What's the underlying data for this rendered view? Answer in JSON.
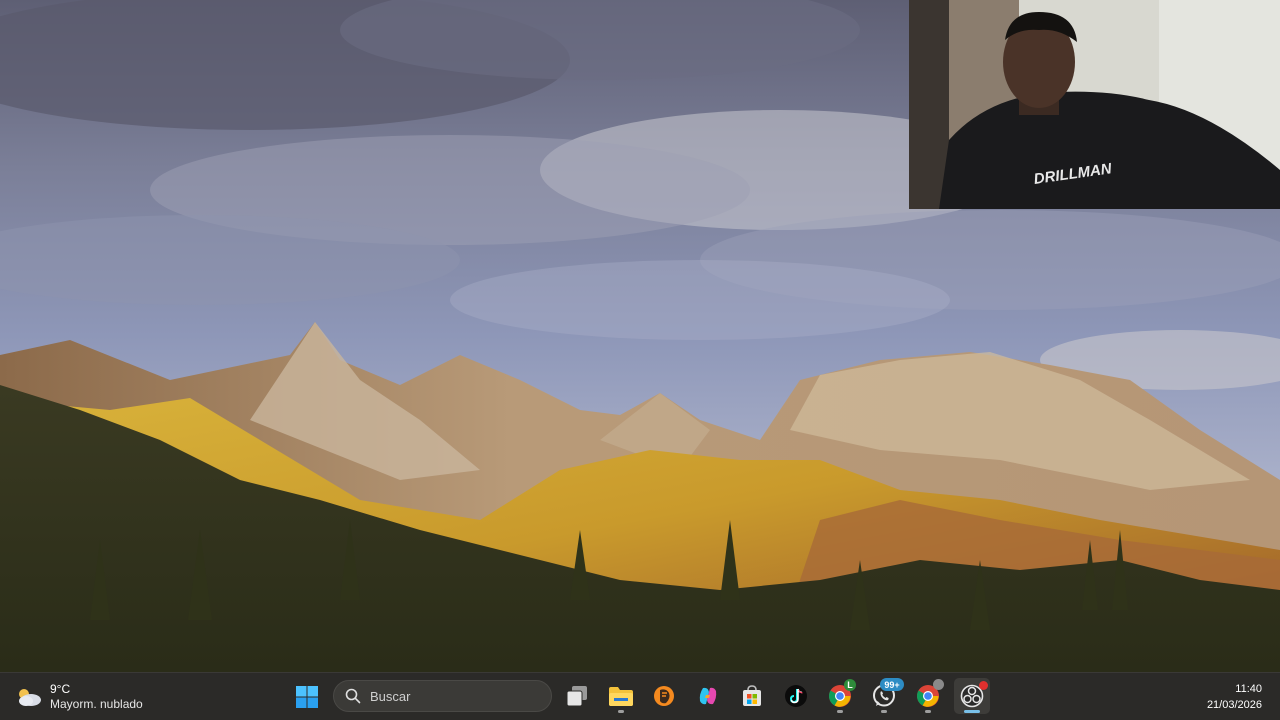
{
  "desktop": {
    "wallpaper": "mountain-landscape-with-clouds"
  },
  "webcam": {
    "shirt_print": "DRILLMAN"
  },
  "taskbar": {
    "weather": {
      "temperature": "9°C",
      "condition": "Mayorm. nublado",
      "icon": "cloud-sun-icon"
    },
    "start_icon": "windows-start-icon",
    "search": {
      "placeholder": "Buscar",
      "icon": "search-icon"
    },
    "apps": [
      {
        "name": "task-view",
        "icon": "task-view-icon"
      },
      {
        "name": "file-explorer",
        "icon": "folder-icon",
        "open": true
      },
      {
        "name": "fl-studio",
        "icon": "fl-studio-icon"
      },
      {
        "name": "copilot",
        "icon": "copilot-icon"
      },
      {
        "name": "microsoft-store",
        "icon": "store-icon"
      },
      {
        "name": "tiktok",
        "icon": "tiktok-icon"
      },
      {
        "name": "chrome",
        "icon": "chrome-icon",
        "badge": "L",
        "open": true
      },
      {
        "name": "whatsapp",
        "icon": "whatsapp-icon",
        "badge": "99+",
        "open": true
      },
      {
        "name": "chrome-profile",
        "icon": "chrome-icon",
        "open": true
      },
      {
        "name": "obs-studio",
        "icon": "obs-icon",
        "open": true,
        "active": true
      }
    ],
    "clock": {
      "time": "11:40",
      "date": "21/03/2026"
    }
  },
  "colors": {
    "taskbar_bg": "#2b2a28",
    "active_indicator": "#79c0e8",
    "whatsapp_badge": "#2d8cc4",
    "chrome_badge": "#2e8b3a"
  }
}
